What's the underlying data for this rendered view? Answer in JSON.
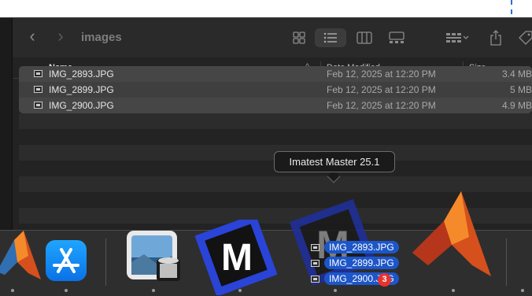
{
  "finder": {
    "title": "images",
    "columns": {
      "name": "Name",
      "date": "Date Modified",
      "size": "Size"
    },
    "files": [
      {
        "name": "IMG_2893.JPG",
        "date": "Feb 12, 2025 at 12:20 PM",
        "size": "3.4 MB"
      },
      {
        "name": "IMG_2899.JPG",
        "date": "Feb 12, 2025 at 12:20 PM",
        "size": "5 MB"
      },
      {
        "name": "IMG_2900.JPG",
        "date": "Feb 12, 2025 at 12:20 PM",
        "size": "4.9 MB"
      }
    ]
  },
  "tooltip": {
    "text": "Imatest Master 25.1"
  },
  "drag": {
    "items": [
      "IMG_2893.JPG",
      "IMG_2899.JPG",
      "IMG_2900.JPG"
    ],
    "count": "3"
  },
  "dock": {
    "apps": [
      "matlab-icon",
      "app-store-icon",
      "preview-icon",
      "imatest-icon",
      "imatest-icon",
      "matlab-icon"
    ]
  },
  "colors": {
    "selection": "#1d56c9",
    "badge": "#e8322e",
    "window_bg": "#232323"
  }
}
